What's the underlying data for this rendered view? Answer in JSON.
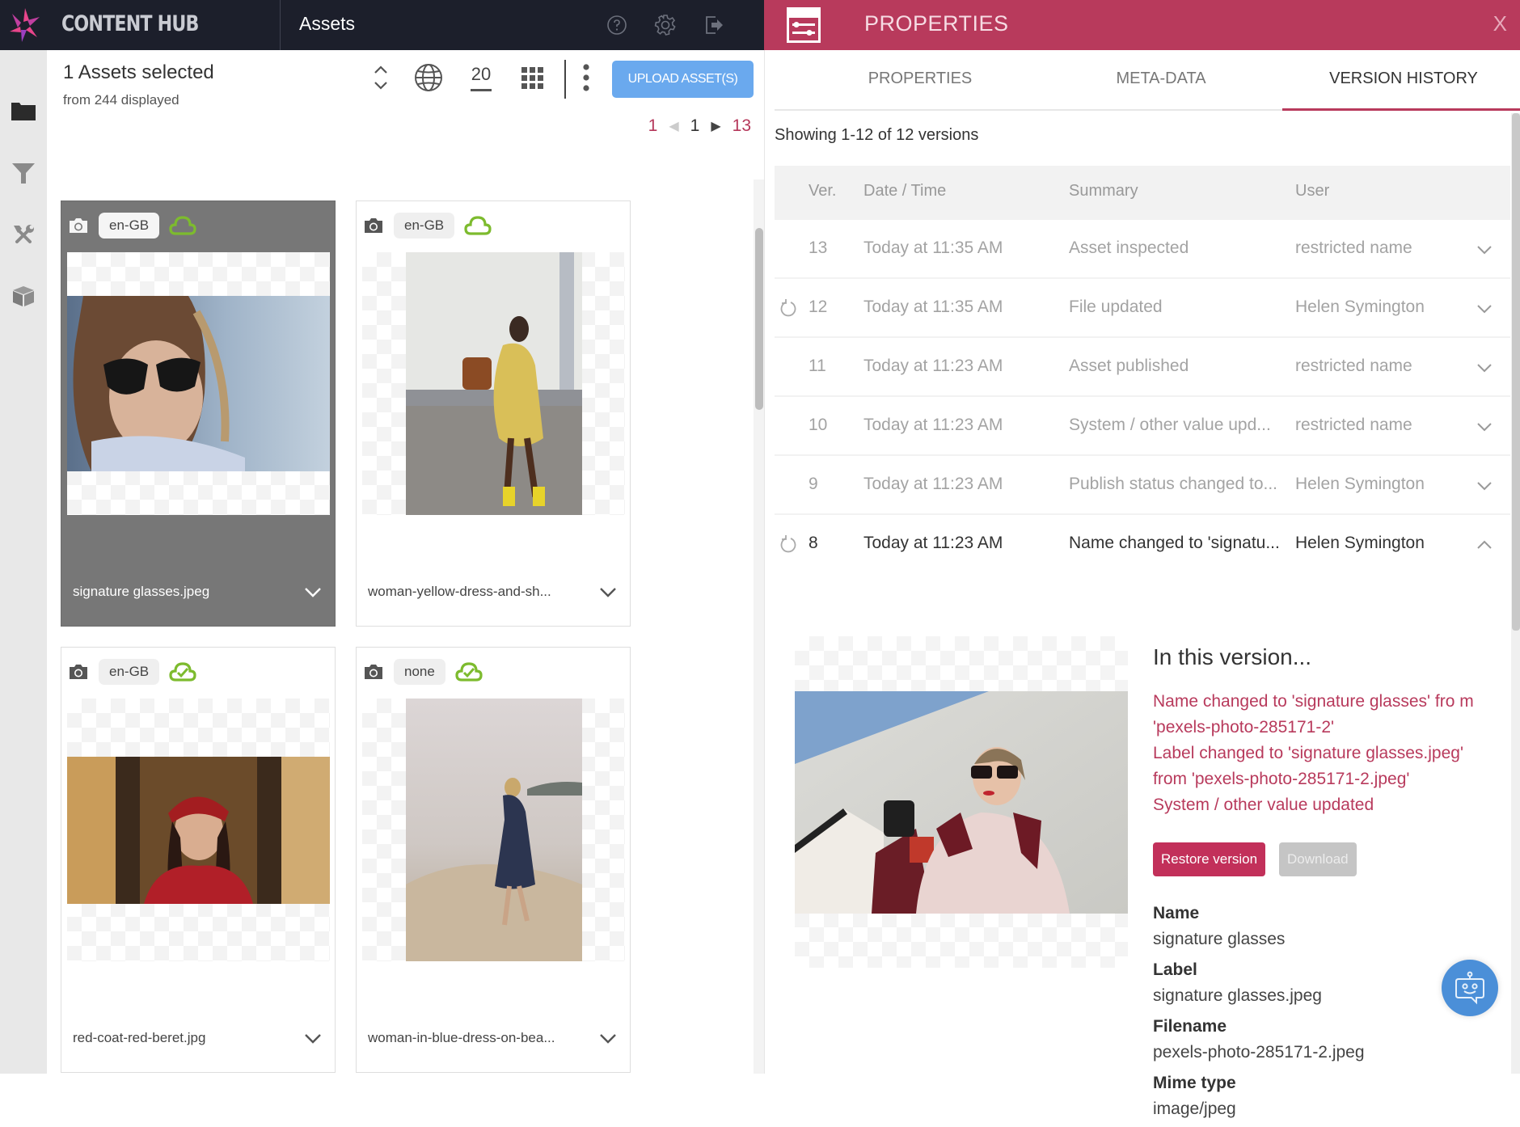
{
  "topbar": {
    "brand": "CONTENT HUB",
    "page_title": "Assets",
    "icons": [
      "help-icon",
      "settings-icon",
      "logout-icon"
    ]
  },
  "rail": {
    "items": [
      {
        "icon": "folder-icon",
        "active": true
      },
      {
        "icon": "filter-icon",
        "active": false
      },
      {
        "icon": "tools-icon",
        "active": false
      },
      {
        "icon": "box-icon",
        "active": false
      }
    ]
  },
  "toolbar": {
    "selected_label": "1 Assets selected",
    "displayed_label": "from 244 displayed",
    "page_size": "20",
    "upload_label": "UPLOAD ASSET(S)"
  },
  "pagination": {
    "first": "1",
    "current": "1",
    "last": "13"
  },
  "assets": [
    {
      "name": "signature glasses.jpeg",
      "locale": "en-GB",
      "selected": true,
      "sync_state": "outline"
    },
    {
      "name": "woman-yellow-dress-and-sh...",
      "locale": "en-GB",
      "selected": false,
      "sync_state": "outline"
    },
    {
      "name": "red-coat-red-beret.jpg",
      "locale": "en-GB",
      "selected": false,
      "sync_state": "check"
    },
    {
      "name": "woman-in-blue-dress-on-bea...",
      "locale": "none",
      "selected": false,
      "sync_state": "check"
    }
  ],
  "panel": {
    "title": "PROPERTIES",
    "close": "X",
    "tabs": [
      {
        "label": "PROPERTIES",
        "active": false
      },
      {
        "label": "META-DATA",
        "active": false
      },
      {
        "label": "VERSION HISTORY",
        "active": true
      }
    ],
    "showing": "Showing 1-12 of 12 versions",
    "columns": {
      "ver": "Ver.",
      "date": "Date / Time",
      "summary": "Summary",
      "user": "User"
    },
    "versions": [
      {
        "ver": "13",
        "date": "Today at 11:35 AM",
        "summary": "Asset inspected",
        "user": "restricted name",
        "restorable": false,
        "expanded": false
      },
      {
        "ver": "12",
        "date": "Today at 11:35 AM",
        "summary": "File updated",
        "user": "Helen Symington",
        "restorable": true,
        "expanded": false
      },
      {
        "ver": "11",
        "date": "Today at 11:23 AM",
        "summary": "Asset published",
        "user": "restricted name",
        "restorable": false,
        "expanded": false
      },
      {
        "ver": "10",
        "date": "Today at 11:23 AM",
        "summary": "System / other value upd...",
        "user": "restricted name",
        "restorable": false,
        "expanded": false
      },
      {
        "ver": "9",
        "date": "Today at 11:23 AM",
        "summary": "Publish status changed to...",
        "user": "Helen Symington",
        "restorable": false,
        "expanded": false
      },
      {
        "ver": "8",
        "date": "Today at 11:23 AM",
        "summary": "Name changed to 'signatu...",
        "user": "Helen Symington",
        "restorable": true,
        "expanded": true
      }
    ],
    "detail": {
      "title": "In this version...",
      "changes": [
        "Name changed to 'signature glasses' fro m 'pexels-photo-285171-2'",
        "Label changed to 'signature glasses.jpeg' from 'pexels-photo-285171-2.jpeg'",
        "System / other value updated"
      ],
      "restore_label": "Restore version",
      "download_label": "Download",
      "properties": [
        {
          "label": "Name",
          "value": "signature glasses"
        },
        {
          "label": "Label",
          "value": "signature glasses.jpeg"
        },
        {
          "label": "Filename",
          "value": "pexels-photo-285171-2.jpeg"
        },
        {
          "label": "Mime type",
          "value": "image/jpeg"
        }
      ]
    }
  },
  "colors": {
    "topbar": "#1c1f2b",
    "accent": "#b83a5c",
    "upload": "#6aa9ee",
    "sync_green": "#7dbb2e",
    "chatbot": "#4b8fd8"
  }
}
